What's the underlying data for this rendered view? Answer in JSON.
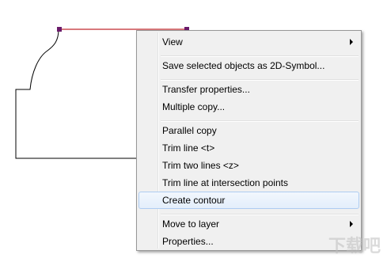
{
  "context_menu": {
    "items": [
      {
        "label": "View",
        "submenu": true
      },
      {
        "label": "Save selected objects as 2D-Symbol...",
        "submenu": false
      },
      {
        "label": "Transfer properties...",
        "submenu": false
      },
      {
        "label": "Multiple copy...",
        "submenu": false
      },
      {
        "label": "Parallel copy",
        "submenu": false
      },
      {
        "label": "Trim line <t>",
        "submenu": false
      },
      {
        "label": "Trim two lines <z>",
        "submenu": false
      },
      {
        "label": "Trim line at intersection points",
        "submenu": false
      },
      {
        "label": "Create contour",
        "submenu": false,
        "highlighted": true
      },
      {
        "label": "Move to layer",
        "submenu": true
      },
      {
        "label": "Properties...",
        "submenu": false
      }
    ]
  },
  "watermark": "下载吧",
  "colors": {
    "selected_line": "#c0282d",
    "handle": "#6a1b6a",
    "highlight_border": "#aeccf1"
  }
}
